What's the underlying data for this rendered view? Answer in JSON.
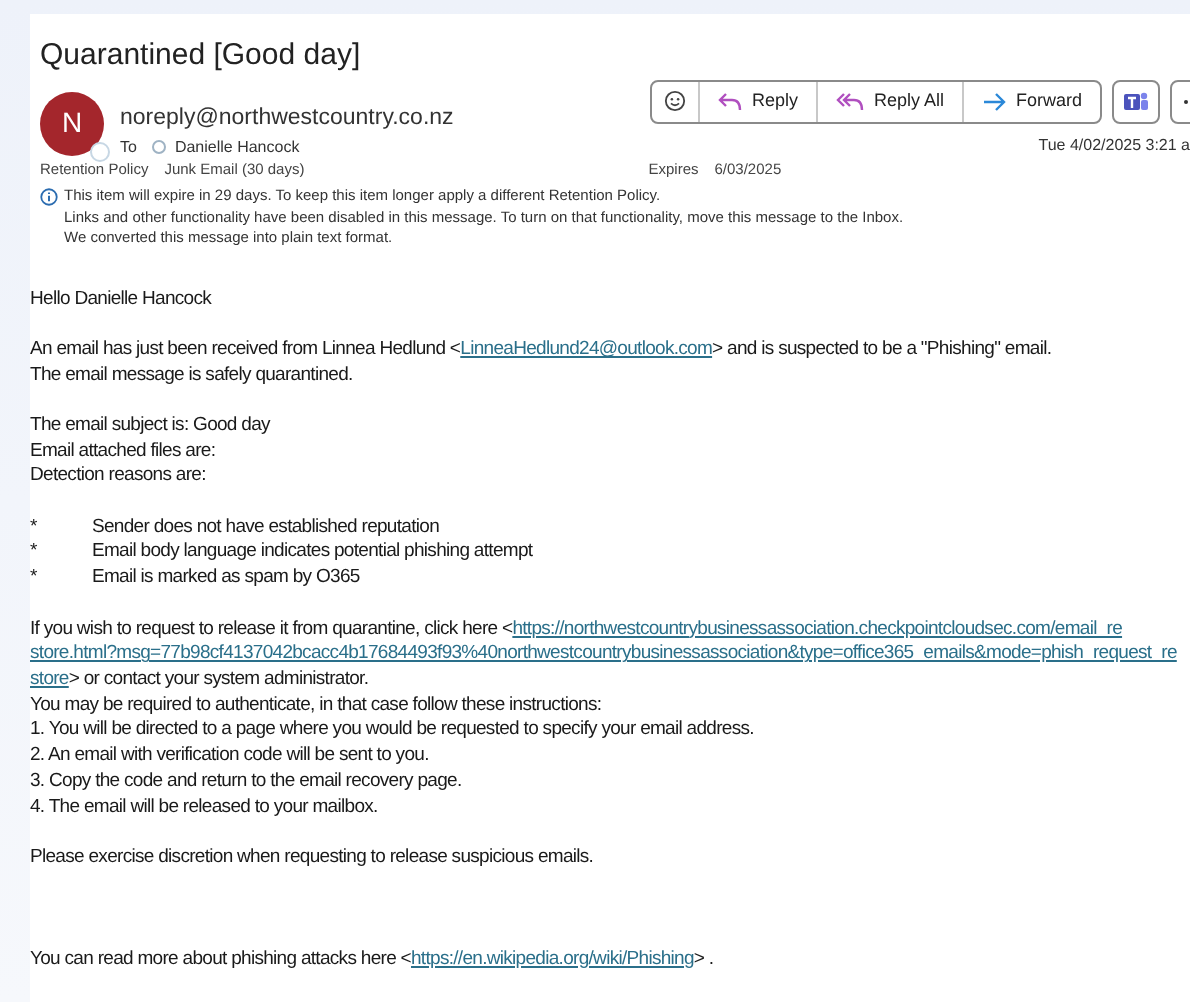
{
  "subject": "Quarantined [Good day]",
  "sender": {
    "initial": "N",
    "address": "noreply@northwestcountry.co.nz",
    "to_label": "To",
    "recipient": "Danielle Hancock",
    "date": "Tue 4/02/2025 3:21 a"
  },
  "actions": [
    {
      "kind": "emoji"
    },
    {
      "kind": "reply",
      "label": "Reply"
    },
    {
      "kind": "reply_all",
      "label": "Reply All"
    },
    {
      "kind": "forward",
      "label": "Forward"
    },
    {
      "kind": "teams"
    },
    {
      "kind": "more"
    }
  ],
  "retention": {
    "label": "Retention Policy",
    "value": "Junk Email (30 days)",
    "expires_label": "Expires",
    "expires": "6/03/2025"
  },
  "info": [
    "This item will expire in 29 days. To keep this item longer apply a different Retention Policy.",
    "Links and other functionality have been disabled in this message. To turn on that functionality, move this message to the Inbox.",
    "We converted this message into plain text format."
  ],
  "body": [
    {
      "kind": "text",
      "parts": [
        {
          "kind": "text",
          "text": "Hello Danielle Hancock"
        }
      ]
    },
    {
      "kind": "blank"
    },
    {
      "kind": "text",
      "parts": [
        {
          "kind": "text",
          "text": "An email has just been received from Linnea Hedlund <"
        },
        {
          "kind": "link",
          "text": "LinneaHedlund24@outlook.com"
        },
        {
          "kind": "text",
          "text": "> and is suspected to be a \"Phishing\" email."
        }
      ]
    },
    {
      "kind": "text",
      "parts": [
        {
          "kind": "text",
          "text": "The email message is safely quarantined."
        }
      ]
    },
    {
      "kind": "blank"
    },
    {
      "kind": "text",
      "parts": [
        {
          "kind": "text",
          "text": "The email subject is: Good day"
        }
      ]
    },
    {
      "kind": "text",
      "parts": [
        {
          "kind": "text",
          "text": "Email attached files are:"
        }
      ]
    },
    {
      "kind": "text",
      "parts": [
        {
          "kind": "text",
          "text": "Detection reasons are:"
        }
      ]
    },
    {
      "kind": "blank"
    },
    {
      "kind": "bullet",
      "marker": "*",
      "parts": [
        {
          "kind": "text",
          "text": "Sender does not have established reputation"
        }
      ]
    },
    {
      "kind": "bullet",
      "marker": "*",
      "parts": [
        {
          "kind": "text",
          "text": "Email body language indicates potential phishing attempt"
        }
      ]
    },
    {
      "kind": "bullet",
      "marker": "*",
      "parts": [
        {
          "kind": "text",
          "text": "Email is marked as spam by O365"
        }
      ]
    },
    {
      "kind": "blank"
    },
    {
      "kind": "text",
      "parts": [
        {
          "kind": "text",
          "text": "If you wish to request to release it from quarantine, click here <"
        },
        {
          "kind": "link",
          "text": "https://northwestcountrybusinessassociation.checkpointcloudsec.com/email_re"
        }
      ]
    },
    {
      "kind": "text",
      "parts": [
        {
          "kind": "link",
          "text": "store.html?msg=77b98cf4137042bcacc4b17684493f93%40northwestcountrybusinessassociation&type=office365_emails&mode=phish_request_re"
        }
      ]
    },
    {
      "kind": "text",
      "parts": [
        {
          "kind": "link",
          "text": "store"
        },
        {
          "kind": "text",
          "text": ">  or contact your system administrator."
        }
      ]
    },
    {
      "kind": "text",
      "parts": [
        {
          "kind": "text",
          "text": "You may be required to authenticate, in that case follow these instructions:"
        }
      ]
    },
    {
      "kind": "text",
      "parts": [
        {
          "kind": "text",
          "text": "1. You will be directed to a page where you would be requested to specify your email address."
        }
      ]
    },
    {
      "kind": "text",
      "parts": [
        {
          "kind": "text",
          "text": "2. An email with verification code will be sent to you."
        }
      ]
    },
    {
      "kind": "text",
      "parts": [
        {
          "kind": "text",
          "text": "3. Copy the code and return to the email recovery page."
        }
      ]
    },
    {
      "kind": "text",
      "parts": [
        {
          "kind": "text",
          "text": "4. The email will be released to your mailbox."
        }
      ]
    },
    {
      "kind": "blank"
    },
    {
      "kind": "text",
      "parts": [
        {
          "kind": "text",
          "text": "Please exercise discretion when requesting to release suspicious emails."
        }
      ]
    },
    {
      "kind": "blank"
    },
    {
      "kind": "blank"
    },
    {
      "kind": "blank"
    },
    {
      "kind": "text",
      "parts": [
        {
          "kind": "text",
          "text": "You can read more about phishing attacks here <"
        },
        {
          "kind": "link",
          "text": "https://en.wikipedia.org/wiki/Phishing"
        },
        {
          "kind": "text",
          "text": "> ."
        }
      ]
    }
  ]
}
